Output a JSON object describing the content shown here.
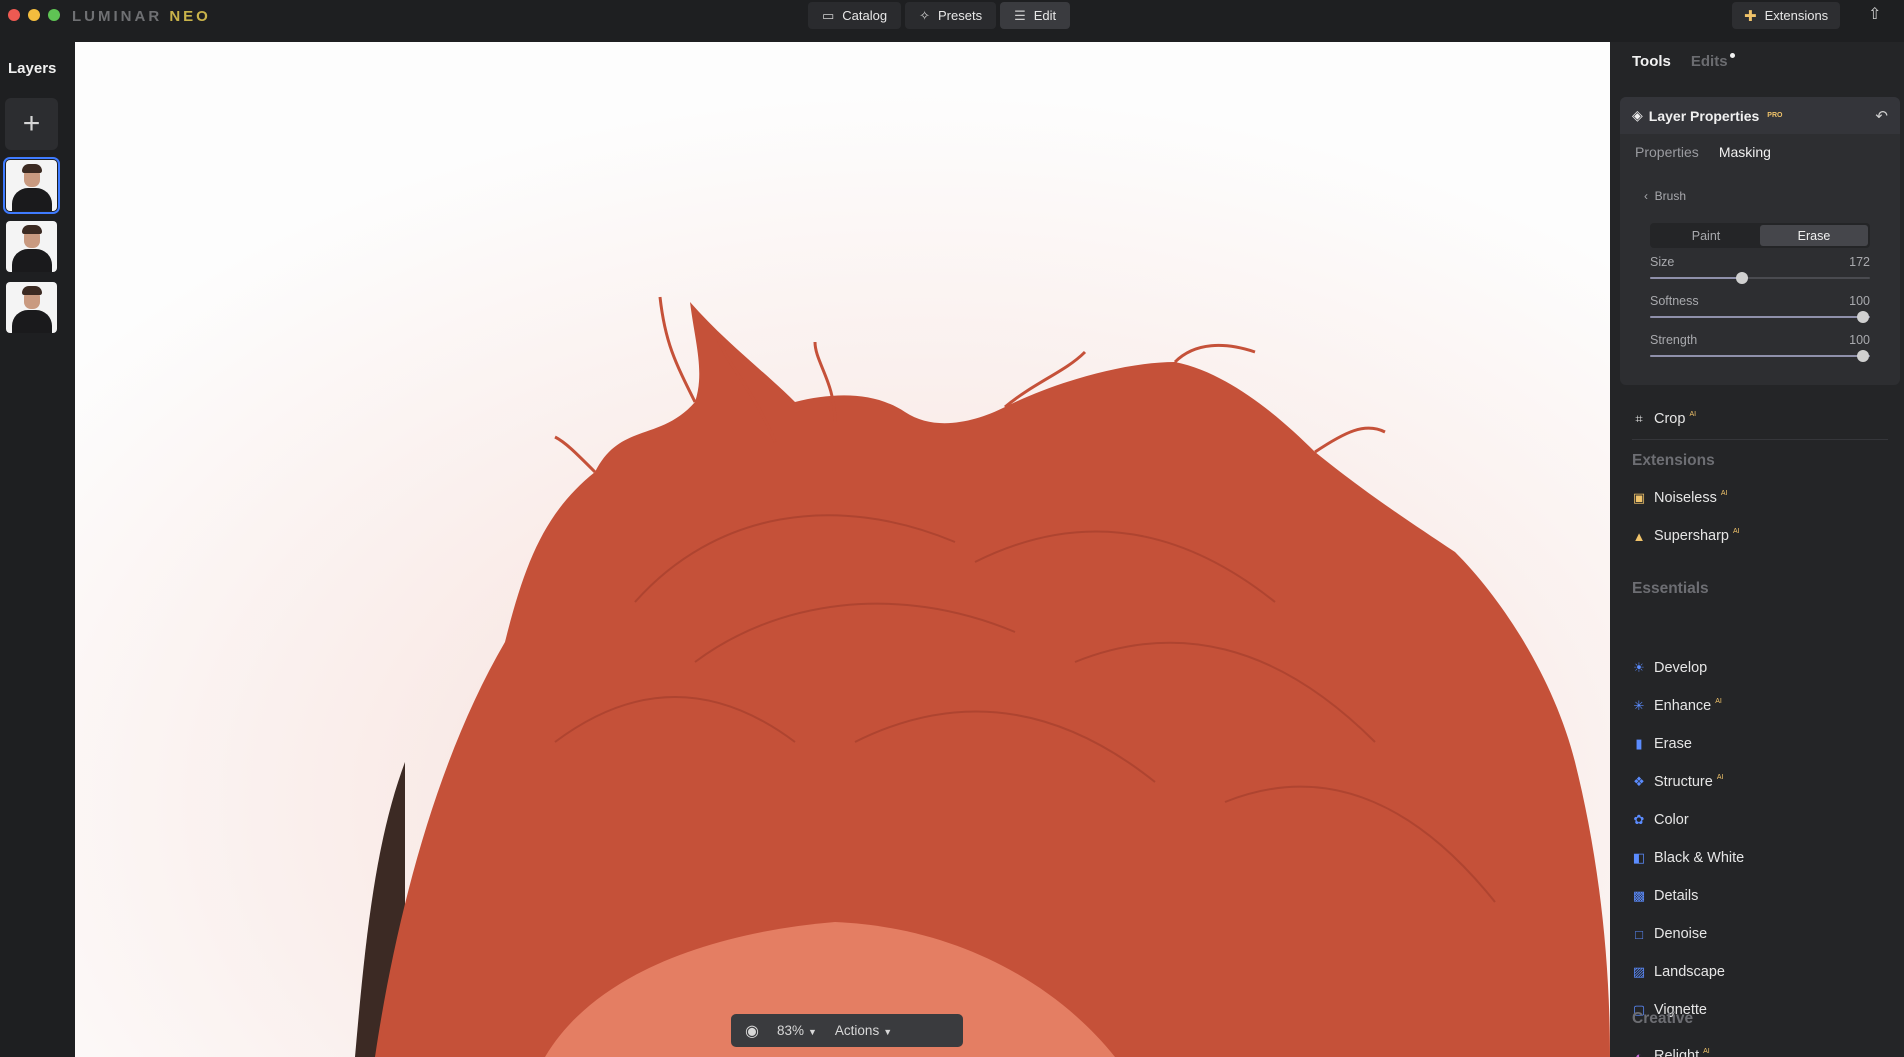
{
  "app": {
    "logo": "LUMINAR",
    "logo_suffix": "NEO"
  },
  "nav": {
    "catalog": "Catalog",
    "presets": "Presets",
    "edit": "Edit",
    "extensions": "Extensions"
  },
  "layers": {
    "title": "Layers",
    "add_symbol": "+",
    "count": 3,
    "selected_index": 0
  },
  "canvas": {
    "zoom": "83%",
    "actions": "Actions"
  },
  "panel": {
    "tab_tools": "Tools",
    "tab_edits": "Edits",
    "layer_properties": {
      "title": "Layer Properties",
      "badge": "PRO",
      "tab_properties": "Properties",
      "tab_masking": "Masking",
      "back_label": "Brush",
      "mode_paint": "Paint",
      "mode_erase": "Erase",
      "active_mode": "Erase",
      "sliders": [
        {
          "label": "Size",
          "value": "172",
          "fraction": 0.42
        },
        {
          "label": "Softness",
          "value": "100",
          "fraction": 1.0
        },
        {
          "label": "Strength",
          "value": "100",
          "fraction": 1.0
        }
      ]
    },
    "crop": "Crop",
    "ai_badge": "AI",
    "extensions_heading": "Extensions",
    "extensions": [
      {
        "label": "Noiseless",
        "icon": "noiseless-icon"
      },
      {
        "label": "Supersharp",
        "icon": "supersharp-icon"
      }
    ],
    "essentials_heading": "Essentials",
    "essentials": [
      {
        "label": "Develop",
        "ai": false
      },
      {
        "label": "Enhance",
        "ai": true
      },
      {
        "label": "Erase",
        "ai": false
      },
      {
        "label": "Structure",
        "ai": true
      },
      {
        "label": "Color",
        "ai": false
      },
      {
        "label": "Black & White",
        "ai": false
      },
      {
        "label": "Details",
        "ai": false
      },
      {
        "label": "Denoise",
        "ai": false
      },
      {
        "label": "Landscape",
        "ai": false
      },
      {
        "label": "Vignette",
        "ai": false
      }
    ],
    "creative_heading": "Creative",
    "creative_first": "Relight"
  },
  "colors": {
    "accent": "#3f7bff",
    "ai_badge": "#f0c36a",
    "mask_overlay": "#c9533d",
    "tool_icon": "#5b8cff"
  }
}
